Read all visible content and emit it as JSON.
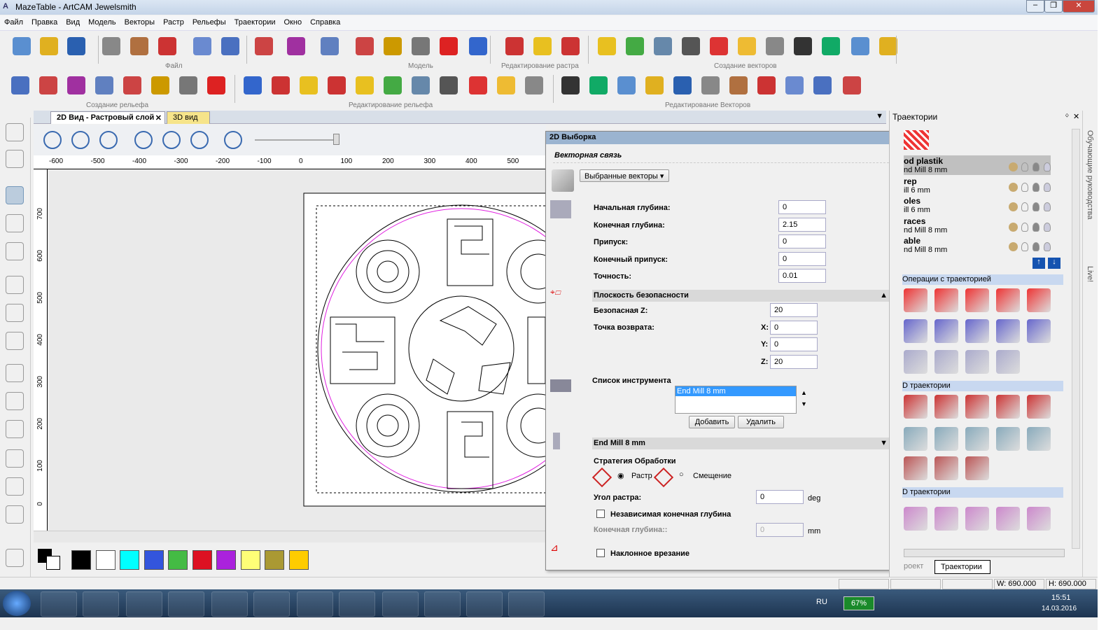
{
  "window": {
    "title": "MazeTable - ArtCAM Jewelsmith",
    "minimize": "‒",
    "maximize": "❐",
    "close": "✕"
  },
  "menu": [
    "Файл",
    "Правка",
    "Вид",
    "Модель",
    "Векторы",
    "Растр",
    "Рельефы",
    "Траектории",
    "Окно",
    "Справка"
  ],
  "toolbar_groups": {
    "file": "Файл",
    "model": "Модель",
    "raster": "Редактирование растра",
    "vectors": "Создание векторов",
    "relief_create": "Создание рельефа",
    "relief_edit": "Редактирование рельефа",
    "vector_edit": "Редактирование Векторов"
  },
  "doc_tabs": [
    {
      "label": "2D Вид - Растровый слой",
      "close": "✕"
    },
    {
      "label": "3D вид"
    }
  ],
  "ruler": {
    "x": [
      "-600",
      "-500",
      "-400",
      "-300",
      "-200",
      "-100",
      "0",
      "100",
      "200",
      "300",
      "400",
      "500"
    ],
    "y": [
      "700",
      "600",
      "500",
      "400",
      "300",
      "200",
      "100",
      "0"
    ]
  },
  "palette": [
    "#000000",
    "#ffffff",
    "#00ffff",
    "#3355dd",
    "#44bb44",
    "#dd1122",
    "#aa22dd",
    "#ffff77",
    "#aa9933",
    "#ffcc00"
  ],
  "dialog": {
    "title": "2D Выборка",
    "section": "Векторная связь",
    "vector_select": "Выбранные векторы",
    "fields": [
      {
        "label": "Начальная глубина:",
        "value": "0"
      },
      {
        "label": "Конечная глубина:",
        "value": "2.15"
      },
      {
        "label": "Припуск:",
        "value": "0"
      },
      {
        "label": "Конечный припуск:",
        "value": "0"
      },
      {
        "label": "Точность:",
        "value": "0.01"
      }
    ],
    "safety": {
      "title": "Плоскость безопасности",
      "safe_z_label": "Безопасная Z:",
      "safe_z": "20",
      "home_label": "Точка возврата:",
      "x_label": "X:",
      "x": "0",
      "y_label": "Y:",
      "y": "0",
      "z_label": "Z:",
      "z": "20"
    },
    "tools": {
      "title": "Список инструмента",
      "items": [
        "End Mill 8 mm"
      ],
      "add": "Добавить",
      "remove": "Удалить"
    },
    "tool_section": "End Mill 8 mm",
    "strategy": {
      "title": "Стратегия Обработки",
      "raster": "Растр",
      "offset": "Смещение",
      "selected": "raster"
    },
    "angle_label": "Угол растра:",
    "angle": "0",
    "angle_unit": "deg",
    "independent": "Независимая конечная глубина",
    "independent_checked": false,
    "final_depth_label": "Конечная глубина::",
    "final_depth": "0",
    "final_depth_unit": "mm",
    "ramp": "Наклонное врезание",
    "ramp_checked": false
  },
  "right_panel": {
    "title": "Траектории",
    "toolpaths": [
      {
        "name": "od plastik",
        "tool": "nd Mill 8 mm"
      },
      {
        "name": "rep",
        "tool": "ill 6 mm"
      },
      {
        "name": "oles",
        "tool": "ill 6 mm"
      },
      {
        "name": "races",
        "tool": "nd Mill 8 mm"
      },
      {
        "name": "able",
        "tool": "nd Mill 8 mm"
      }
    ],
    "sec_ops": "Операции с траекторией",
    "sec_2d": "D траектории",
    "sec_3d": "D траектории",
    "bottom_tabs": [
      "роект",
      "Траектории"
    ]
  },
  "side_tabs": [
    "Обучающие руководства",
    "Live!"
  ],
  "status": {
    "w": "W: 690.000",
    "h": "H: 690.000"
  },
  "taskbar": {
    "lang": "RU",
    "battery": "67%",
    "time": "15:51",
    "date": "14.03.2016"
  }
}
